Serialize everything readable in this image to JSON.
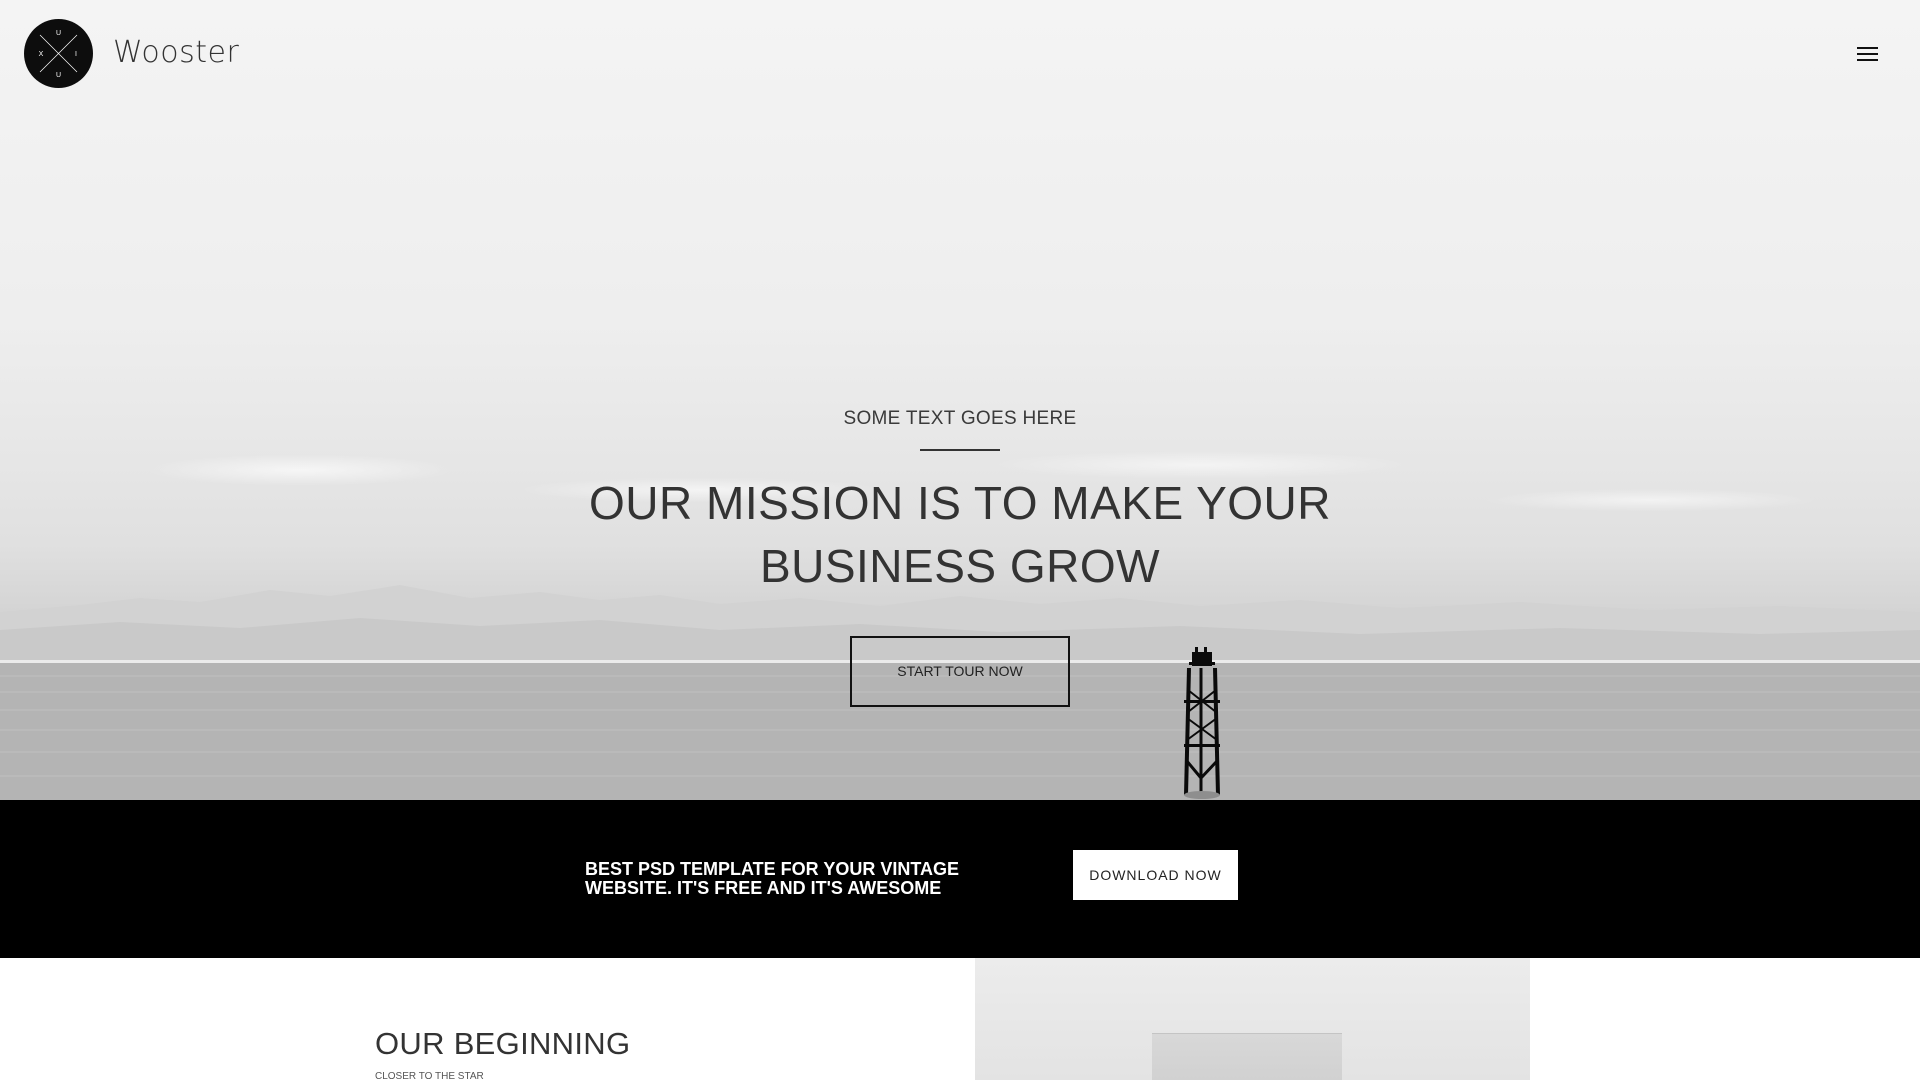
{
  "header": {
    "logo": {
      "icon": "xuiu-logo-icon",
      "letters": [
        "U",
        "X",
        "I",
        "U"
      ],
      "color": "#0d0d0d"
    },
    "brand_name": "Wooster",
    "menu_icon": "hamburger-menu-icon"
  },
  "hero": {
    "eyebrow": "SOME TEXT GOES HERE",
    "headline": "OUR MISSION IS TO MAKE YOUR BUSINESS GROW",
    "cta_label": "START TOUR NOW",
    "background_image": "misty-sea-with-navigation-marker"
  },
  "cta_strip": {
    "text": "BEST PSD TEMPLATE FOR YOUR VINTAGE WEBSITE. IT'S FREE AND IT'S AWESOME",
    "button_label": "DOWNLOAD NOW",
    "background": "#000000"
  },
  "section_beginning": {
    "heading": "OUR BEGINNING",
    "subheading": "CLOSER TO THE STAR"
  }
}
